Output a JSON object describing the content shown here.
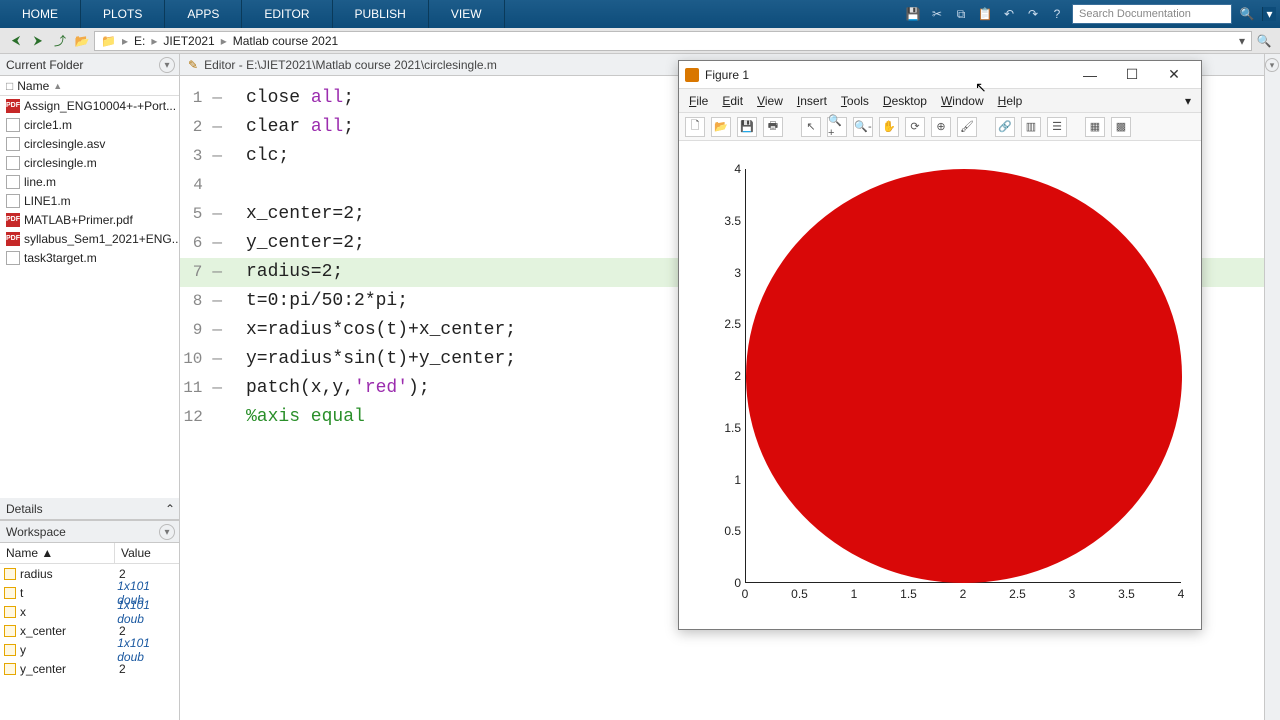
{
  "toolstrip": {
    "tabs": [
      "HOME",
      "PLOTS",
      "APPS",
      "EDITOR",
      "PUBLISH",
      "VIEW"
    ],
    "search_placeholder": "Search Documentation"
  },
  "address": {
    "drive": "E:",
    "segs": [
      "JIET2021",
      "Matlab course 2021"
    ]
  },
  "current_folder": {
    "title": "Current Folder",
    "name_hdr": "Name",
    "files": [
      {
        "name": "Assign_ENG10004+-+Port...",
        "icon": "pdf"
      },
      {
        "name": "circle1.m",
        "icon": "m"
      },
      {
        "name": "circlesingle.asv",
        "icon": "asv"
      },
      {
        "name": "circlesingle.m",
        "icon": "m"
      },
      {
        "name": "line.m",
        "icon": "m"
      },
      {
        "name": "LINE1.m",
        "icon": "m"
      },
      {
        "name": "MATLAB+Primer.pdf",
        "icon": "pdf"
      },
      {
        "name": "syllabus_Sem1_2021+ENG...",
        "icon": "pdf"
      },
      {
        "name": "task3target.m",
        "icon": "m"
      }
    ]
  },
  "details": {
    "title": "Details"
  },
  "workspace": {
    "title": "Workspace",
    "hdr_name": "Name ▲",
    "hdr_value": "Value",
    "vars": [
      {
        "name": "radius",
        "value": "2",
        "ital": false
      },
      {
        "name": "t",
        "value": "1x101 doub",
        "ital": true
      },
      {
        "name": "x",
        "value": "1x101 doub",
        "ital": true
      },
      {
        "name": "x_center",
        "value": "2",
        "ital": false
      },
      {
        "name": "y",
        "value": "1x101 doub",
        "ital": true
      },
      {
        "name": "y_center",
        "value": "2",
        "ital": false
      }
    ]
  },
  "editor": {
    "title": "Editor - E:\\JIET2021\\Matlab course 2021\\circlesingle.m",
    "lines": [
      {
        "n": 1,
        "dash": true,
        "seg": [
          {
            "t": "close "
          },
          {
            "t": "all",
            "c": "kw-str"
          },
          {
            "t": ";"
          }
        ]
      },
      {
        "n": 2,
        "dash": true,
        "seg": [
          {
            "t": "clear "
          },
          {
            "t": "all",
            "c": "kw-str"
          },
          {
            "t": ";"
          }
        ]
      },
      {
        "n": 3,
        "dash": true,
        "seg": [
          {
            "t": "clc;"
          }
        ]
      },
      {
        "n": 4,
        "dash": false,
        "seg": [
          {
            "t": ""
          }
        ]
      },
      {
        "n": 5,
        "dash": true,
        "seg": [
          {
            "t": "x_center=2;"
          }
        ]
      },
      {
        "n": 6,
        "dash": true,
        "seg": [
          {
            "t": "y_center=2;"
          }
        ]
      },
      {
        "n": 7,
        "dash": true,
        "hl": true,
        "seg": [
          {
            "t": "radius=2;"
          }
        ]
      },
      {
        "n": 8,
        "dash": true,
        "seg": [
          {
            "t": "t=0:pi/50:2*pi;"
          }
        ]
      },
      {
        "n": 9,
        "dash": true,
        "seg": [
          {
            "t": "x=radius*cos(t)+x_center;"
          }
        ]
      },
      {
        "n": 10,
        "dash": true,
        "seg": [
          {
            "t": "y=radius*sin(t)+y_center;"
          }
        ]
      },
      {
        "n": 11,
        "dash": true,
        "seg": [
          {
            "t": "patch(x,y,"
          },
          {
            "t": "'red'",
            "c": "kw-str"
          },
          {
            "t": ");"
          }
        ]
      },
      {
        "n": 12,
        "dash": false,
        "seg": [
          {
            "t": "%axis equal",
            "c": "cmt"
          }
        ]
      }
    ]
  },
  "figure": {
    "title": "Figure 1",
    "menu": [
      "File",
      "Edit",
      "View",
      "Insert",
      "Tools",
      "Desktop",
      "Window",
      "Help"
    ],
    "yticks": [
      "0",
      "0.5",
      "1",
      "1.5",
      "2",
      "2.5",
      "3",
      "3.5",
      "4"
    ],
    "xticks": [
      "0",
      "0.5",
      "1",
      "1.5",
      "2",
      "2.5",
      "3",
      "3.5",
      "4"
    ]
  },
  "chart_data": {
    "type": "patch",
    "title": "",
    "shape": "circle",
    "x_center": 2,
    "y_center": 2,
    "radius": 2,
    "fill": "#d90808",
    "xlim": [
      0,
      4
    ],
    "ylim": [
      0,
      4
    ],
    "xticks": [
      0,
      0.5,
      1,
      1.5,
      2,
      2.5,
      3,
      3.5,
      4
    ],
    "yticks": [
      0,
      0.5,
      1,
      1.5,
      2,
      2.5,
      3,
      3.5,
      4
    ]
  }
}
